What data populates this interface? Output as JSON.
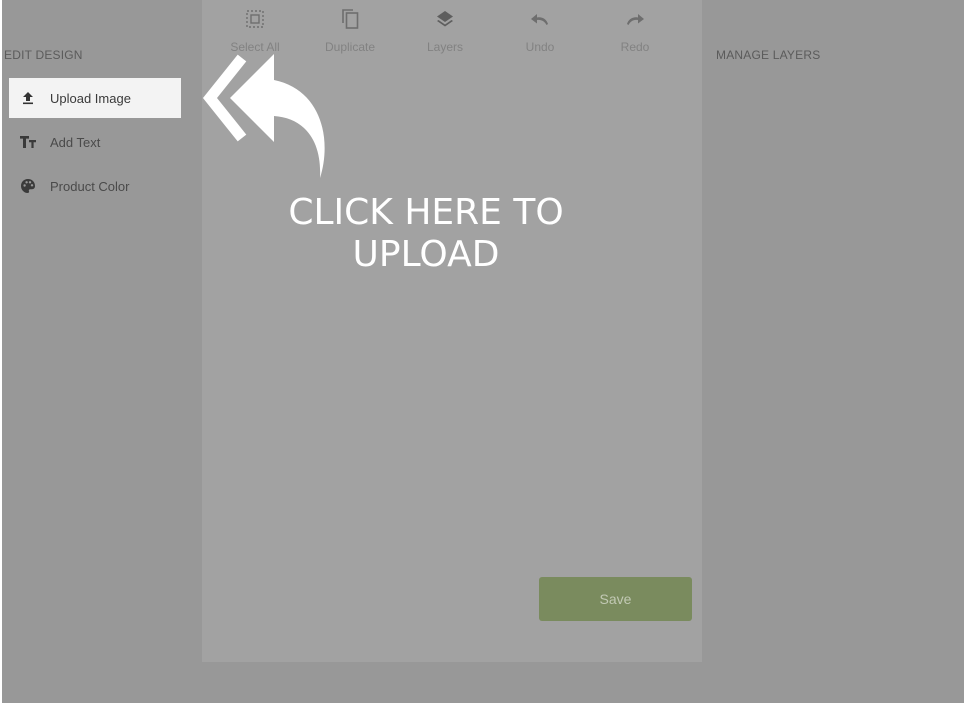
{
  "left_panel": {
    "title": "EDIT DESIGN",
    "items": [
      {
        "label": "Upload Image",
        "icon": "upload-icon",
        "active": true
      },
      {
        "label": "Add Text",
        "icon": "text-size-icon",
        "active": false
      },
      {
        "label": "Product Color",
        "icon": "palette-icon",
        "active": false
      }
    ]
  },
  "toolbar": {
    "items": [
      {
        "label": "Select All",
        "icon": "select-all-icon"
      },
      {
        "label": "Duplicate",
        "icon": "duplicate-icon"
      },
      {
        "label": "Layers",
        "icon": "layers-icon"
      },
      {
        "label": "Undo",
        "icon": "undo-icon"
      },
      {
        "label": "Redo",
        "icon": "redo-icon"
      }
    ]
  },
  "right_panel": {
    "title": "MANAGE LAYERS"
  },
  "canvas": {
    "save_label": "Save"
  },
  "overlay": {
    "hint_line1": "CLICK HERE TO",
    "hint_line2": "UPLOAD"
  },
  "colors": {
    "overlay": "#989898",
    "canvas": "#a2a2a2",
    "save_button": "#7a8b5e"
  }
}
